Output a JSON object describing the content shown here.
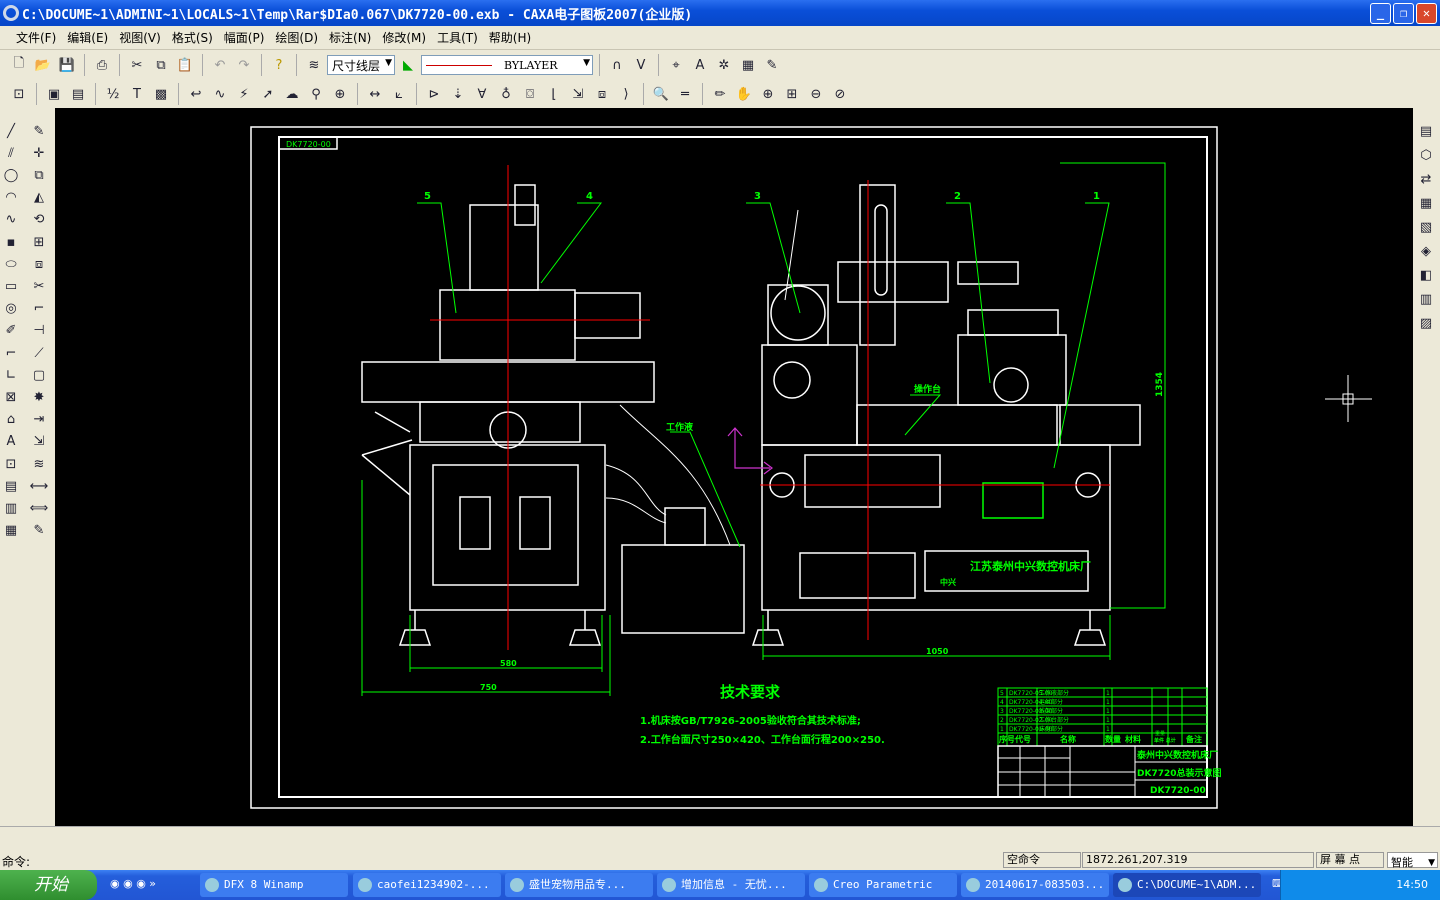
{
  "window": {
    "title": "C:\\DOCUME~1\\ADMINI~1\\LOCALS~1\\Temp\\Rar$DIa0.067\\DK7720-00.exb - CAXA电子图板2007(企业版)",
    "buttons": [
      "_",
      "❐",
      "✕"
    ]
  },
  "menu": [
    "文件(F)",
    "编辑(E)",
    "视图(V)",
    "格式(S)",
    "幅面(P)",
    "绘图(D)",
    "标注(N)",
    "修改(M)",
    "工具(T)",
    "帮助(H)"
  ],
  "toolbar": {
    "layer": "尺寸线层",
    "linetype": "BYLAYER",
    "line_color": "#cc0000"
  },
  "drawing": {
    "stamp": "DK7720-00",
    "part_numbers": [
      "5",
      "4",
      "3",
      "2",
      "1"
    ],
    "dims": {
      "height": "1354",
      "width_right": "1050",
      "width_left_inner": "580",
      "width_left_outer": "750"
    },
    "labels": {
      "coolant": "工作液",
      "console": "操作台",
      "factory_plate": "江苏泰州中兴数控机床厂",
      "brand": "中兴"
    },
    "tech_title": "技术要求",
    "tech_req": [
      "1.机床按GB/T7926-2005验收符合其技术标准;",
      "2.工作台面尺寸250×420、工作台面行程200×250."
    ],
    "bom": [
      {
        "no": "5",
        "code": "DK7720-05-00",
        "name": "工作液部分",
        "qty": "1"
      },
      {
        "no": "4",
        "code": "DK7720-04-00",
        "name": "运丝部分",
        "qty": "1"
      },
      {
        "no": "3",
        "code": "DK7720-03-00",
        "name": "线架部分",
        "qty": "1"
      },
      {
        "no": "2",
        "code": "DK7720-02-00",
        "name": "工作台部分",
        "qty": "1"
      },
      {
        "no": "1",
        "code": "DK7720-01-00",
        "name": "床身部分",
        "qty": "1"
      }
    ],
    "bom_header": [
      "序号",
      "代号",
      "名称",
      "数量",
      "材料",
      "单件 总计",
      "备注"
    ],
    "bom_weight": "重量",
    "title_block": {
      "company": "泰州中兴数控机床厂",
      "drawing_name": "DK7720总装示意图",
      "drawing_no": "DK7720-00"
    },
    "colors": {
      "outline": "#ffffff",
      "text": "#00ff00",
      "center": "#ff0000",
      "dim": "#00ff00",
      "ucs": "#cc33cc"
    }
  },
  "status": {
    "command_label": "命令:",
    "state": "空命令",
    "coords": "1872.261,207.319",
    "snap": "屏 幕 点",
    "mode": "智能"
  },
  "taskbar": {
    "start": "开始",
    "tasks": [
      "DFX 8 Winamp",
      "caofei1234902-...",
      "盛世宠物用品专...",
      "增加信息 - 无忧...",
      "Creo Parametric",
      "20140617-083503...",
      "C:\\DOCUME~1\\ADM..."
    ],
    "clock": "14:50"
  }
}
